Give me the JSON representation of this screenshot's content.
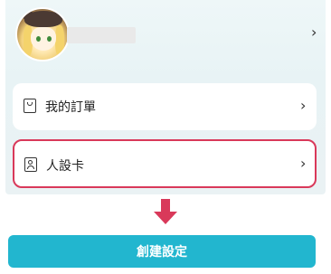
{
  "profile": {
    "avatar_alt": "anime avatar",
    "name_placeholder": "",
    "chevron": "›"
  },
  "menu": [
    {
      "label": "我的訂單",
      "icon": "shopping-bag-icon",
      "chevron": "›"
    },
    {
      "label": "人設卡",
      "icon": "person-card-icon",
      "chevron": "›"
    }
  ],
  "highlight": {
    "color": "#d9395a"
  },
  "cta": {
    "label": "創建設定",
    "color": "#22b6cf"
  }
}
